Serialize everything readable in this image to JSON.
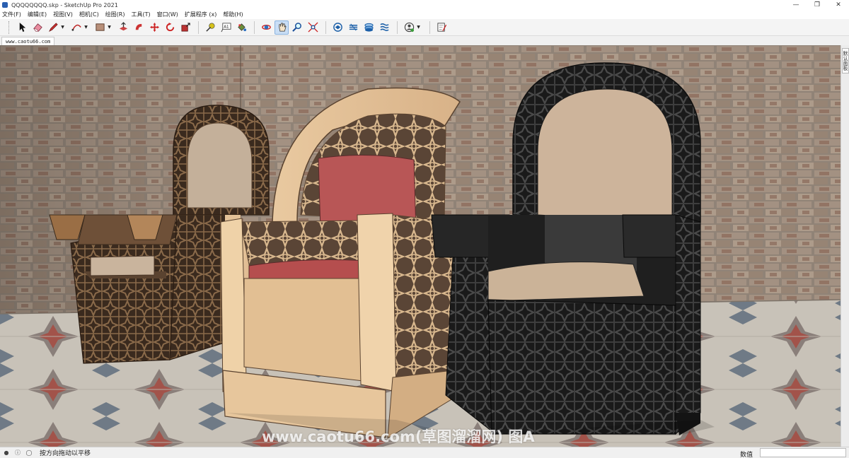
{
  "window": {
    "title": "QQQQQQQQ.skp - SketchUp Pro 2021",
    "minimize": "—",
    "maximize": "❐",
    "close": "✕"
  },
  "menu": {
    "items": [
      "文件(F)",
      "编辑(E)",
      "视图(V)",
      "相机(C)",
      "绘图(R)",
      "工具(T)",
      "窗口(W)",
      "扩展程序 (x)",
      "帮助(H)"
    ]
  },
  "toolbar": {
    "tools": [
      {
        "name": "select-tool",
        "icon": "arrow-icon"
      },
      {
        "name": "eraser-tool",
        "icon": "eraser-icon"
      },
      {
        "name": "line-tool",
        "icon": "pencil-icon"
      },
      {
        "name": "arc-tool",
        "icon": "arc-icon"
      },
      {
        "name": "rectangle-tool",
        "icon": "rectangle-icon"
      },
      {
        "name": "push-pull-tool",
        "icon": "push-pull-icon"
      },
      {
        "name": "follow-me-tool",
        "icon": "follow-me-icon"
      },
      {
        "name": "move-tool",
        "icon": "move-icon"
      },
      {
        "name": "rotate-tool",
        "icon": "rotate-icon"
      },
      {
        "name": "scale-tool",
        "icon": "scale-icon"
      },
      {
        "name": "tape-measure-tool",
        "icon": "tape-measure-icon"
      },
      {
        "name": "text-tool",
        "icon": "text-icon"
      },
      {
        "name": "paint-bucket-tool",
        "icon": "paint-bucket-icon"
      },
      {
        "name": "orbit-tool",
        "icon": "orbit-icon"
      },
      {
        "name": "pan-tool",
        "icon": "hand-icon"
      },
      {
        "name": "zoom-tool",
        "icon": "zoom-icon"
      },
      {
        "name": "zoom-extents-tool",
        "icon": "zoom-extents-icon"
      },
      {
        "name": "warehouse-button",
        "icon": "warehouse-icon"
      },
      {
        "name": "extension-warehouse-button",
        "icon": "extension-icon"
      },
      {
        "name": "layout-button",
        "icon": "layout-icon"
      },
      {
        "name": "extension-manager-button",
        "icon": "extension-manager-icon"
      },
      {
        "name": "account-button",
        "icon": "user-icon"
      },
      {
        "name": "send-to-layout-button",
        "icon": "document-edit-icon"
      }
    ],
    "text_tool_label": "A1"
  },
  "scene_tab": {
    "label": "www.caotu66.com"
  },
  "viewport": {
    "watermark": "www.caotu66.com(草图溜溜网) 图A"
  },
  "tray": {
    "tab_label": "默认面板"
  },
  "statusbar": {
    "hint": "按方向拖动以平移",
    "measurements_label": "数值",
    "measurements_value": ""
  },
  "colors": {
    "toolbar_bg": "#f4f4f4",
    "active_tool": "#c9def5",
    "wood_light": "#e6c49a",
    "wood_dark": "#5a4330",
    "cushion_red": "#b85656",
    "cushion_beige": "#cfb59b",
    "black_chair": "#2b2b2b"
  }
}
